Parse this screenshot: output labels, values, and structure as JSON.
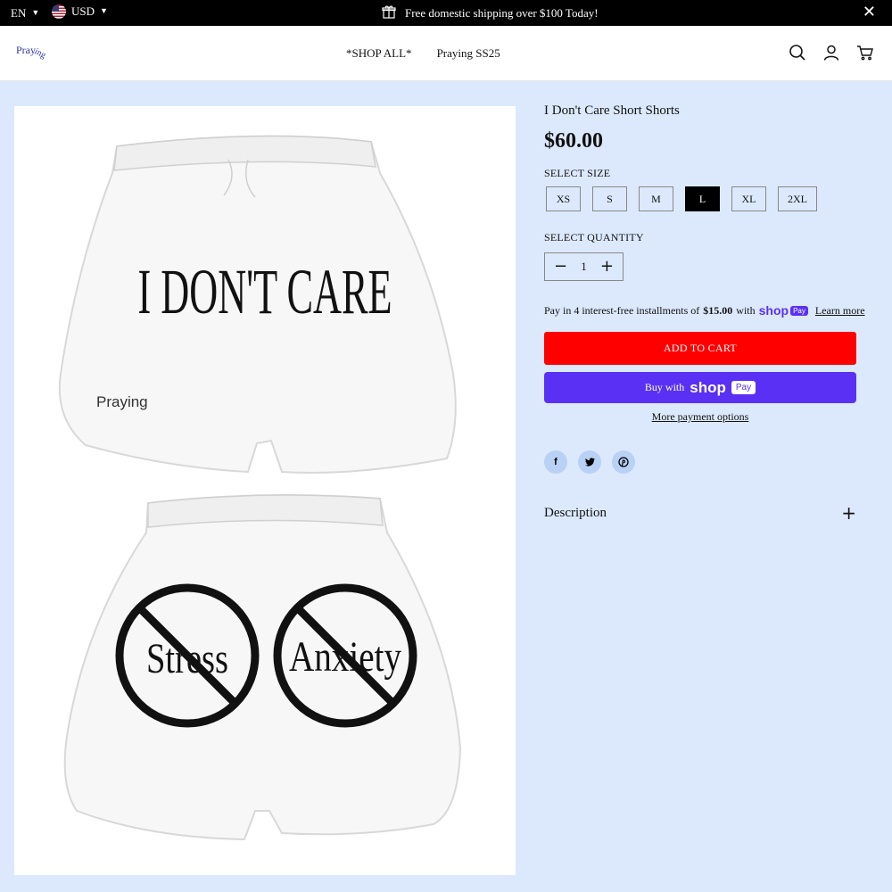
{
  "topbar": {
    "language": "EN",
    "currency": "USD",
    "announcement": "Free domestic shipping over $100 Today!",
    "icons": {
      "flag": "us-flag-icon",
      "gift": "gift-icon",
      "close": "close-icon"
    }
  },
  "header": {
    "logo_text": "Pray",
    "logo_tail": "ing",
    "nav": [
      "*SHOP ALL*",
      "Praying SS25"
    ],
    "icons": [
      "search-icon",
      "account-icon",
      "cart-icon"
    ]
  },
  "gallery": {
    "front_text": "I DON'T CARE",
    "brand_mark": "Praying",
    "back_words": [
      "Stress",
      "Anxiety"
    ]
  },
  "product": {
    "title": "I Don't Care Short Shorts",
    "price": "$60.00",
    "select_size_label": "SELECT SIZE",
    "sizes": [
      "XS",
      "S",
      "M",
      "L",
      "XL",
      "2XL"
    ],
    "selected_size": "L",
    "select_quantity_label": "SELECT QUANTITY",
    "quantity": "1",
    "installments": {
      "prefix": "Pay in 4 interest-free installments of",
      "amount": "$15.00",
      "with": "with",
      "shop": "shop",
      "pay": "Pay",
      "learn_more": "Learn more"
    },
    "add_to_cart": "ADD TO CART",
    "buy_with": "Buy with",
    "more_payment": "More payment options",
    "shares": [
      "f",
      "t",
      "p"
    ],
    "description_label": "Description"
  },
  "colors": {
    "page_bg": "#dce9fc",
    "add_to_cart": "#ff0000",
    "shop_pay": "#5a31f4",
    "share_bg": "#b8d1f4"
  }
}
